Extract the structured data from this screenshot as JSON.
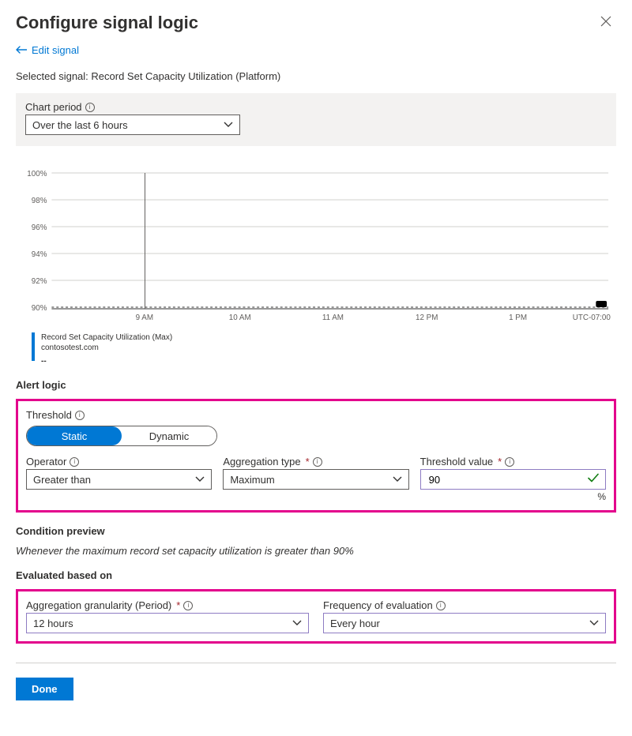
{
  "header": {
    "title": "Configure signal logic",
    "edit_signal": "Edit signal"
  },
  "selectedSignal": "Selected signal: Record Set Capacity Utilization (Platform)",
  "chartPeriod": {
    "label": "Chart period",
    "value": "Over the last 6 hours"
  },
  "chart_data": {
    "type": "line",
    "title": "",
    "xlabel": "",
    "ylabel": "",
    "ylim": [
      90,
      100
    ],
    "categories": [
      "9 AM",
      "10 AM",
      "11 AM",
      "12 PM",
      "1 PM",
      "UTC-07:00"
    ],
    "y_ticks": [
      "100%",
      "98%",
      "96%",
      "94%",
      "92%",
      "90%"
    ],
    "threshold_line": 90,
    "series": [
      {
        "name": "Record Set Capacity Utilization (Max)",
        "values": []
      }
    ]
  },
  "legend": {
    "title": "Record Set Capacity Utilization (Max)",
    "subtitle": "contosotest.com",
    "value": "--"
  },
  "alertLogic": {
    "heading": "Alert logic",
    "threshold_label": "Threshold",
    "threshold_options": {
      "static": "Static",
      "dynamic": "Dynamic"
    },
    "operator_label": "Operator",
    "operator_value": "Greater than",
    "aggregation_label": "Aggregation type",
    "aggregation_value": "Maximum",
    "threshold_value_label": "Threshold value",
    "threshold_value": "90",
    "threshold_unit": "%"
  },
  "preview": {
    "heading": "Condition preview",
    "text": "Whenever the maximum record set capacity utilization is greater than 90%"
  },
  "evaluation": {
    "heading": "Evaluated based on",
    "granularity_label": "Aggregation granularity (Period)",
    "granularity_value": "12 hours",
    "frequency_label": "Frequency of evaluation",
    "frequency_value": "Every hour"
  },
  "footer": {
    "done": "Done"
  }
}
